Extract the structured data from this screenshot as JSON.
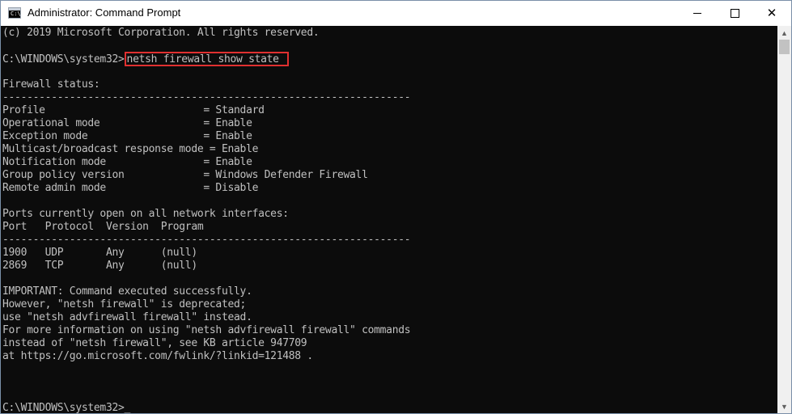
{
  "window": {
    "title": "Administrator: Command Prompt",
    "icon_label": "C:\\."
  },
  "console": {
    "lines": [
      "(c) 2019 Microsoft Corporation. All rights reserved.",
      "",
      "",
      "",
      "Firewall status:",
      "-------------------------------------------------------------------",
      "Profile                          = Standard",
      "Operational mode                 = Enable",
      "Exception mode                   = Enable",
      "Multicast/broadcast response mode = Enable",
      "Notification mode                = Enable",
      "Group policy version             = Windows Defender Firewall",
      "Remote admin mode                = Disable",
      "",
      "Ports currently open on all network interfaces:",
      "Port   Protocol  Version  Program",
      "-------------------------------------------------------------------",
      "1900   UDP       Any      (null)",
      "2869   TCP       Any      (null)",
      "",
      "IMPORTANT: Command executed successfully.",
      "However, \"netsh firewall\" is deprecated;",
      "use \"netsh advfirewall firewall\" instead.",
      "For more information on using \"netsh advfirewall firewall\" commands",
      "instead of \"netsh firewall\", see KB article 947709",
      "at https://go.microsoft.com/fwlink/?linkid=121488 .",
      "",
      "",
      "",
      ""
    ],
    "prompt_1": "C:\\WINDOWS\\system32>",
    "command": "netsh firewall show state",
    "prompt_2": "C:\\WINDOWS\\system32>",
    "cursor": "_"
  },
  "colors": {
    "console_bg": "#0c0c0c",
    "console_fg": "#c0c0c0",
    "highlight_box": "#e03030"
  },
  "icons": [
    "cmd-app-icon",
    "minimize-icon",
    "maximize-icon",
    "close-icon",
    "scroll-up-arrow-icon",
    "scroll-down-arrow-icon"
  ]
}
